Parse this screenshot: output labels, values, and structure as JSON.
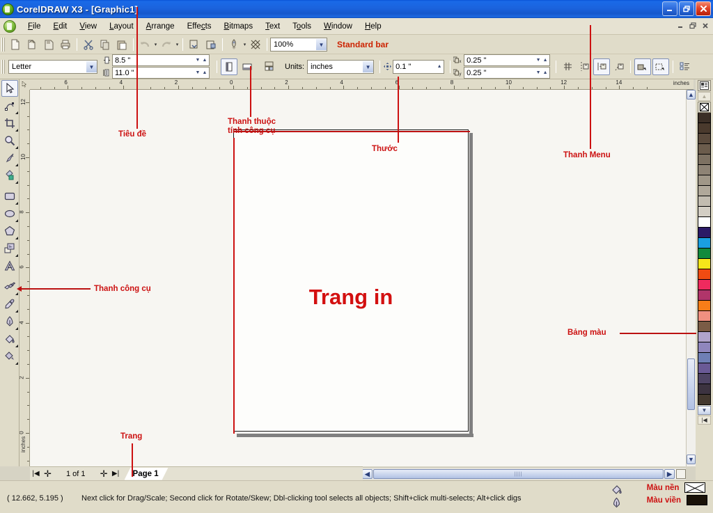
{
  "window": {
    "title": "CorelDRAW X3 - [Graphic1]",
    "app_icon": "coreldraw-balloon-icon",
    "controls": [
      {
        "name": "minimize-button",
        "glyph": "minimize-icon"
      },
      {
        "name": "restore-button",
        "glyph": "restore-icon"
      },
      {
        "name": "close-button",
        "glyph": "close-icon"
      }
    ],
    "mdi_controls": [
      {
        "name": "child-minimize-button",
        "glyph": "minimize-icon"
      },
      {
        "name": "child-restore-button",
        "glyph": "restore-icon"
      },
      {
        "name": "child-close-button",
        "glyph": "close-icon"
      }
    ]
  },
  "menubar": {
    "doc_icon": "document-control-icon",
    "items": [
      {
        "label": "File",
        "accel": "F"
      },
      {
        "label": "Edit",
        "accel": "E"
      },
      {
        "label": "View",
        "accel": "V"
      },
      {
        "label": "Layout",
        "accel": "L"
      },
      {
        "label": "Arrange",
        "accel": "A"
      },
      {
        "label": "Effects",
        "accel": "c"
      },
      {
        "label": "Bitmaps",
        "accel": "B"
      },
      {
        "label": "Text",
        "accel": "T"
      },
      {
        "label": "Tools",
        "accel": "o"
      },
      {
        "label": "Window",
        "accel": "W"
      },
      {
        "label": "Help",
        "accel": "H"
      }
    ]
  },
  "standard_bar": {
    "label": "Standard bar",
    "zoom_value": "100%",
    "buttons": [
      {
        "name": "new-button",
        "icon": "new-document-icon"
      },
      {
        "name": "open-button",
        "icon": "open-folder-icon"
      },
      {
        "name": "save-button",
        "icon": "save-disk-icon"
      },
      {
        "name": "print-button",
        "icon": "printer-icon"
      },
      {
        "name": "cut-button",
        "icon": "scissors-icon"
      },
      {
        "name": "copy-button",
        "icon": "copy-icon"
      },
      {
        "name": "paste-button",
        "icon": "paste-icon"
      },
      {
        "name": "undo-button",
        "icon": "undo-arrow-icon"
      },
      {
        "name": "redo-button",
        "icon": "redo-arrow-icon"
      },
      {
        "name": "import-button",
        "icon": "import-icon"
      },
      {
        "name": "export-button",
        "icon": "export-icon"
      },
      {
        "name": "application-launcher-button",
        "icon": "rocket-icon"
      },
      {
        "name": "corel-online-button",
        "icon": "corel-online-icon"
      }
    ]
  },
  "property_bar": {
    "paper_type": "Letter",
    "paper_width": "8.5 \"",
    "paper_height": "11.0 \"",
    "width_icon": "page-width-icon",
    "height_icon": "page-height-icon",
    "orientation_portrait_icon": "portrait-icon",
    "orientation_landscape_icon": "landscape-icon",
    "page_layout_icon": "page-setup-icon",
    "units_label": "Units:",
    "units_value": "inches",
    "nudge_icon": "nudge-offset-icon",
    "nudge_value": "0.1 \"",
    "duplicate_x_label": "x",
    "duplicate_y_label": "y",
    "duplicate_x_value": "0.25 \"",
    "duplicate_y_value": "0.25 \"",
    "right_buttons": [
      {
        "name": "snap-to-grid-button",
        "icon": "snap-grid-icon"
      },
      {
        "name": "snap-to-guidelines-button",
        "icon": "snap-guideline-icon"
      },
      {
        "name": "snap-to-objects-button",
        "icon": "snap-object-icon"
      },
      {
        "name": "dynamic-guides-button",
        "icon": "dynamic-guides-icon"
      },
      {
        "name": "treat-as-filled-button",
        "icon": "treat-as-filled-icon"
      },
      {
        "name": "wireframe-button",
        "icon": "wireframe-icon"
      },
      {
        "name": "options-button",
        "icon": "options-list-icon"
      }
    ]
  },
  "toolbox": {
    "tools": [
      {
        "name": "pick-tool",
        "icon": "arrow-cursor-icon",
        "selected": true,
        "flyout": false
      },
      {
        "name": "shape-tool",
        "icon": "shape-node-icon",
        "selected": false,
        "flyout": true
      },
      {
        "name": "crop-tool",
        "icon": "crop-icon",
        "selected": false,
        "flyout": true
      },
      {
        "name": "zoom-tool",
        "icon": "magnifier-icon",
        "selected": false,
        "flyout": true
      },
      {
        "name": "freehand-tool",
        "icon": "pencil-icon",
        "selected": false,
        "flyout": true
      },
      {
        "name": "smart-fill-tool",
        "icon": "smart-fill-icon",
        "selected": false,
        "flyout": true
      },
      {
        "name": "rectangle-tool",
        "icon": "rectangle-icon",
        "selected": false,
        "flyout": true
      },
      {
        "name": "ellipse-tool",
        "icon": "ellipse-icon",
        "selected": false,
        "flyout": true
      },
      {
        "name": "polygon-tool",
        "icon": "polygon-icon",
        "selected": false,
        "flyout": true
      },
      {
        "name": "basic-shapes-tool",
        "icon": "basic-shapes-icon",
        "selected": false,
        "flyout": true
      },
      {
        "name": "text-tool",
        "icon": "letter-a-icon",
        "selected": false,
        "flyout": false
      },
      {
        "name": "blend-tool",
        "icon": "interactive-blend-icon",
        "selected": false,
        "flyout": true
      },
      {
        "name": "eyedropper-tool",
        "icon": "eyedropper-icon",
        "selected": false,
        "flyout": true
      },
      {
        "name": "outline-tool",
        "icon": "outline-pen-icon",
        "selected": false,
        "flyout": true
      },
      {
        "name": "fill-tool",
        "icon": "paint-bucket-icon",
        "selected": false,
        "flyout": true
      },
      {
        "name": "interactive-fill-tool",
        "icon": "interactive-fill-icon",
        "selected": false,
        "flyout": true
      }
    ]
  },
  "rulers": {
    "unit_label": "inches",
    "horizontal_ticks": [
      "6",
      "4",
      "2",
      "0",
      "2",
      "4",
      "6",
      "8",
      "10",
      "12",
      "14"
    ],
    "vertical_ticks": [
      "12",
      "10",
      "8",
      "6",
      "4",
      "2",
      "0"
    ]
  },
  "canvas": {
    "page_label": "Trang in"
  },
  "annotations": [
    {
      "name": "annotation-title-bar",
      "text": "Tiêu đề"
    },
    {
      "name": "annotation-property-bar",
      "text": "Thanh thuộc\ntính công cụ"
    },
    {
      "name": "annotation-ruler",
      "text": "Thước"
    },
    {
      "name": "annotation-menu-bar",
      "text": "Thanh Menu"
    },
    {
      "name": "annotation-toolbox",
      "text": "Thanh công cụ"
    },
    {
      "name": "annotation-palette",
      "text": "Bảng màu"
    },
    {
      "name": "annotation-page",
      "text": "Trang"
    }
  ],
  "page_navigator": {
    "first_icon": "first-page-icon",
    "add_before_icon": "add-page-icon",
    "count_label": "1 of 1",
    "add_after_icon": "add-page-icon",
    "last_icon": "last-page-icon",
    "tab_label": "Page 1"
  },
  "statusbar": {
    "coords": "( 12.662, 5.195  )",
    "hint": "Next click for Drag/Scale; Second click for Rotate/Skew; Dbl-clicking tool selects all objects; Shift+click multi-selects; Alt+click digs",
    "fill_icon": "paint-bucket-icon",
    "outline_icon": "outline-pen-icon",
    "fill_label": "Màu nền",
    "outline_label": "Màu viền",
    "fill_value": "none",
    "outline_value": "#1a1208"
  },
  "palette": {
    "options_icon": "palette-options-icon",
    "scroll_up_icon": "scroll-up-icon",
    "scroll_down_icon": "scroll-down-icon",
    "expand_icon": "expand-palette-icon",
    "no_color_icon": "no-color-icon",
    "swatches": [
      "#3b2f26",
      "#4a3a2d",
      "#5a4a3c",
      "#6b5c4c",
      "#7d7162",
      "#8e8375",
      "#a09788",
      "#b0a89a",
      "#c2bcb0",
      "#d3cec4",
      "#ffffff",
      "#2b1a66",
      "#1a9fe0",
      "#118a3c",
      "#f5e61a",
      "#f04b12",
      "#ef2a5e",
      "#b0356a",
      "#f77d18",
      "#f09080",
      "#7a5c46",
      "#b0a4cc",
      "#8f86bd",
      "#6f7fb5",
      "#6a5a96",
      "#4e4464",
      "#3c3340",
      "#43382e"
    ]
  },
  "scrollbars": {
    "h_left_icon": "scroll-left-icon",
    "h_right_icon": "scroll-right-icon",
    "v_up_icon": "scroll-up-icon",
    "v_down_icon": "scroll-down-icon"
  }
}
